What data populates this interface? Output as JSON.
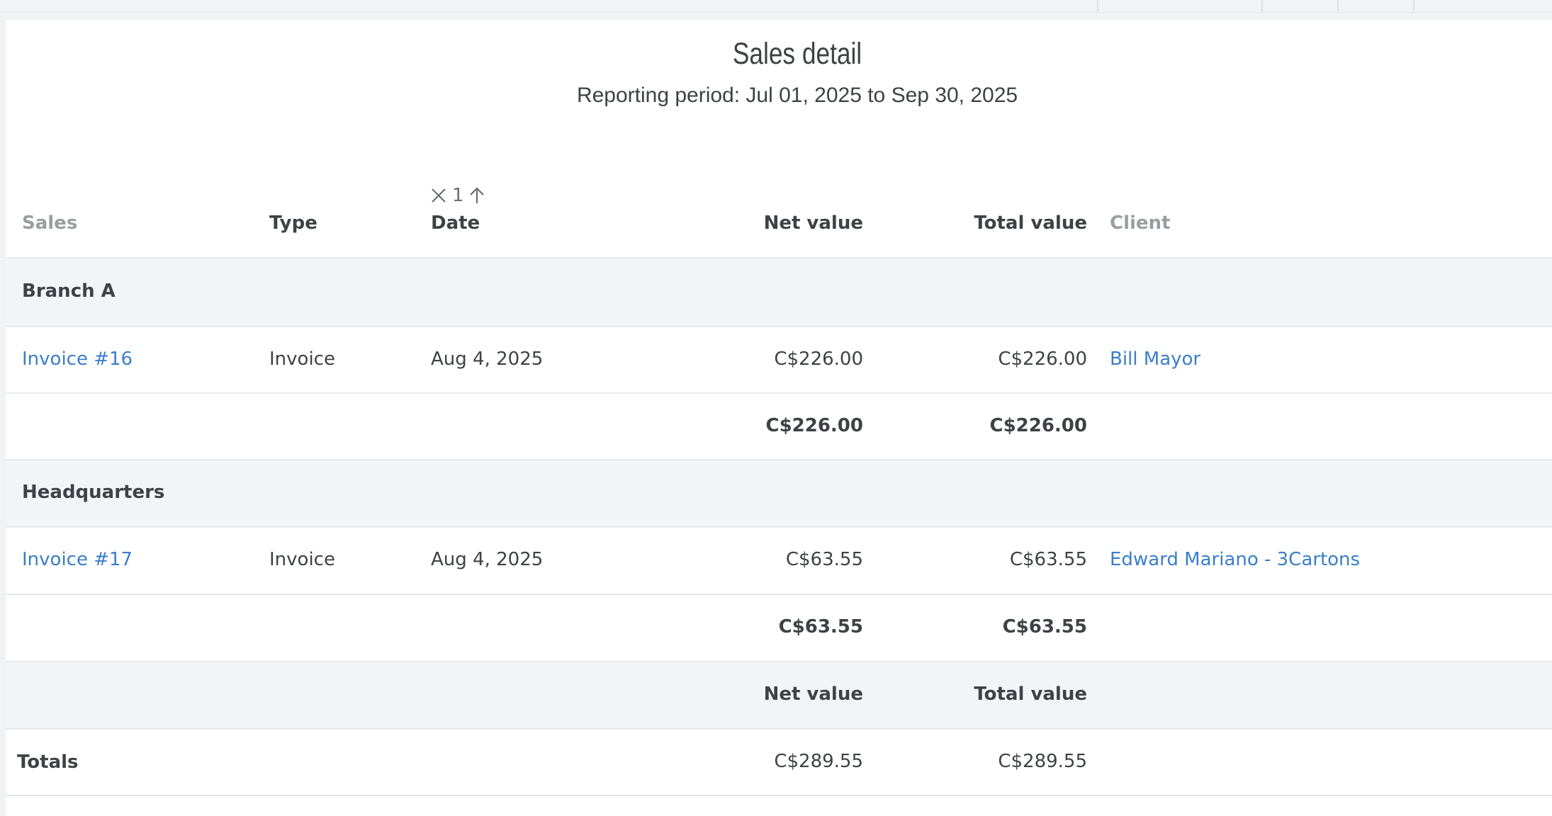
{
  "report": {
    "title": "Sales detail",
    "period": "Reporting period: Jul 01, 2025 to Sep 30, 2025"
  },
  "columns": {
    "sales": "Sales",
    "type": "Type",
    "date": "Date",
    "net_value": "Net value",
    "total_value": "Total value",
    "client": "Client"
  },
  "sort": {
    "priority": "1",
    "direction": "ascending"
  },
  "groups": [
    {
      "name": "Branch A",
      "rows": [
        {
          "sale": "Invoice #16",
          "type": "Invoice",
          "date": "Aug 4, 2025",
          "net": "C$226.00",
          "total": "C$226.00",
          "client": "Bill Mayor"
        }
      ],
      "subtotal": {
        "net": "C$226.00",
        "total": "C$226.00"
      }
    },
    {
      "name": "Headquarters",
      "rows": [
        {
          "sale": "Invoice #17",
          "type": "Invoice",
          "date": "Aug 4, 2025",
          "net": "C$63.55",
          "total": "C$63.55",
          "client": "Edward Mariano - 3Cartons"
        }
      ],
      "subtotal": {
        "net": "C$63.55",
        "total": "C$63.55"
      }
    }
  ],
  "totals": {
    "header_net": "Net value",
    "header_total": "Total value",
    "label": "Totals",
    "net": "C$289.55",
    "total": "C$289.55"
  },
  "colors": {
    "link": "#3b7ec9",
    "text": "#3e4146",
    "muted": "#9a9da2",
    "group_bg": "#f3f4f7"
  }
}
